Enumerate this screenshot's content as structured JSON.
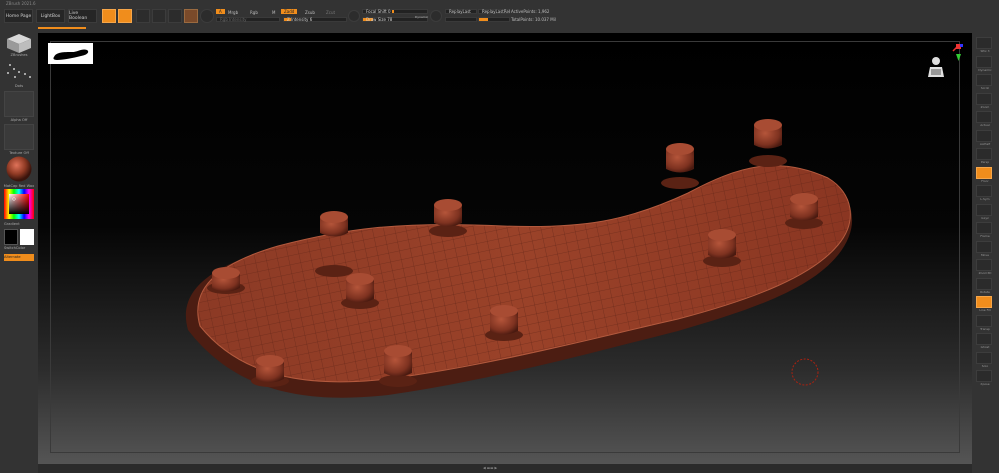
{
  "app": {
    "version": "ZBrush 2021.6"
  },
  "toolbar": {
    "home_page": "Home Page",
    "lightbox": "LightBox",
    "live_boolean": "Live Boolean",
    "tools": [
      {
        "name": "edit",
        "label": "Edit",
        "on": true
      },
      {
        "name": "draw",
        "label": "Draw",
        "on": true
      },
      {
        "name": "move",
        "label": "Move",
        "on": false
      },
      {
        "name": "scale",
        "label": "Scale",
        "on": false
      },
      {
        "name": "rotate",
        "label": "Rotate",
        "on": false
      }
    ],
    "a_label": "A",
    "mrgb": "Mrgb",
    "rgb": "Rgb",
    "m": "M",
    "zadd": "Zadd",
    "zsub": "Zsub",
    "zcut": "Zcut",
    "rgb_intensity": "Rgb Intensity",
    "z_intensity": "Z Intensity 6",
    "focal_shift": "Focal Shift 0",
    "draw_size": "Draw Size 78",
    "dynamic": "Dynamic",
    "replay_last": "ReplayLast",
    "replay_last_rel": "ReplayLastRel",
    "active_points": "ActivePoints: 1,962",
    "total_points": "TotalPoints: 10.037 Mil"
  },
  "left_panel": {
    "tool_label": "ZBrushes",
    "dots_label": "Dots",
    "alpha_label": "Alpha Off",
    "texture_label": "Texture Off",
    "material_label": "MatCap Red Wax",
    "gradient_label": "Gradient",
    "switch_color": "SwitchColor",
    "alternate": "Alternate"
  },
  "right_panel": [
    {
      "icon": "sphere-icon",
      "label": "SPix 3"
    },
    {
      "icon": "dynamic-icon",
      "label": "Dynamic"
    },
    {
      "icon": "scroll-icon",
      "label": "Scroll"
    },
    {
      "icon": "zoom-icon",
      "label": "Zoom"
    },
    {
      "icon": "actual-icon",
      "label": "Actual"
    },
    {
      "icon": "aahalf-icon",
      "label": "AAHalf"
    },
    {
      "icon": "persp-icon",
      "label": "Persp"
    },
    {
      "icon": "floor-icon",
      "label": "Floor"
    },
    {
      "icon": "local-icon",
      "label": "L.Sym"
    },
    {
      "icon": "xyz-icon",
      "label": "Gxyz"
    },
    {
      "icon": "frame-icon",
      "label": "Frame"
    },
    {
      "icon": "move-icon",
      "label": "Move"
    },
    {
      "icon": "zoom3d-icon",
      "label": "Zoom3D"
    },
    {
      "icon": "rotate-icon",
      "label": "Rotate"
    },
    {
      "icon": "linefill-icon",
      "label": "Line Fill"
    },
    {
      "icon": "transp-icon",
      "label": "Transp"
    },
    {
      "icon": "ghost-icon",
      "label": "Ghost"
    },
    {
      "icon": "solo-icon",
      "label": "Solo"
    },
    {
      "icon": "xpose-icon",
      "label": "Xpose"
    }
  ],
  "colors": {
    "accent": "#f08d1c",
    "mesh": "#8a3a24"
  }
}
